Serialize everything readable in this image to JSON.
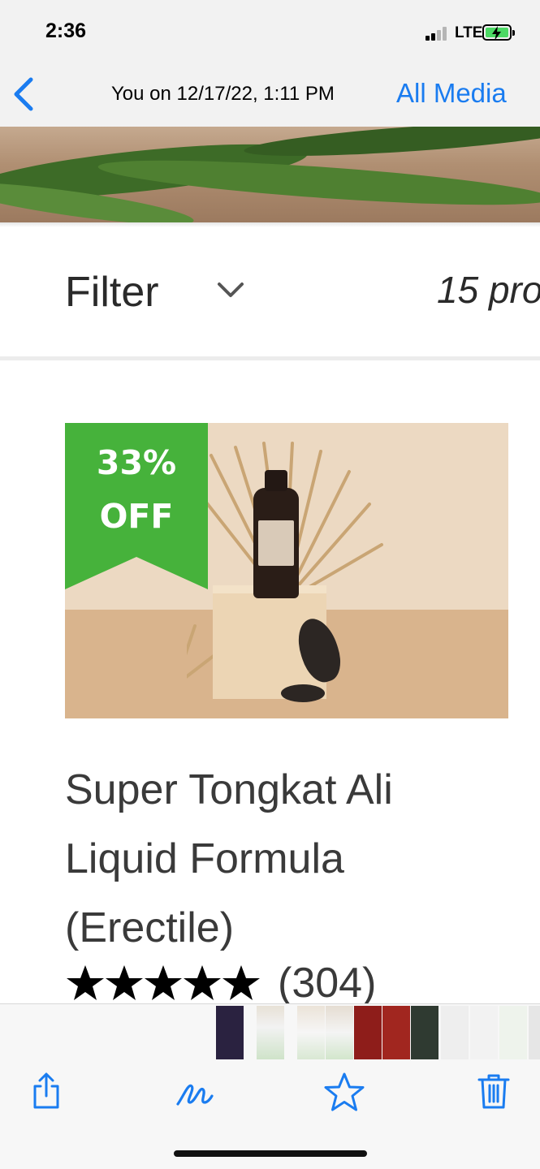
{
  "status_bar": {
    "time": "2:36",
    "network": "LTE",
    "signal_bars": 2,
    "signal_bars_total": 4,
    "battery": "charging"
  },
  "nav": {
    "back_icon": "chevron-left-icon",
    "title": "You on 12/17/22, 1:11 PM",
    "all_media_label": "All Media"
  },
  "photo": {
    "filter_label": "Filter",
    "filter_icon": "chevron-down-icon",
    "product_count": "15 pro",
    "product": {
      "discount_line1": "33%",
      "discount_line2": "OFF",
      "title_lines": [
        "Super Tongkat Ali",
        "Liquid Formula",
        "(Erectile)"
      ],
      "rating": 5,
      "rating_max": 5,
      "reviews": "(304)"
    }
  },
  "toolbar": {
    "items": [
      {
        "name": "share-icon"
      },
      {
        "name": "markup-icon"
      },
      {
        "name": "favorite-star-icon"
      },
      {
        "name": "trash-icon"
      }
    ]
  },
  "colors": {
    "accent": "#1a7cf0",
    "discount_green": "#46b23b",
    "text_dark": "#3a3a3a"
  }
}
